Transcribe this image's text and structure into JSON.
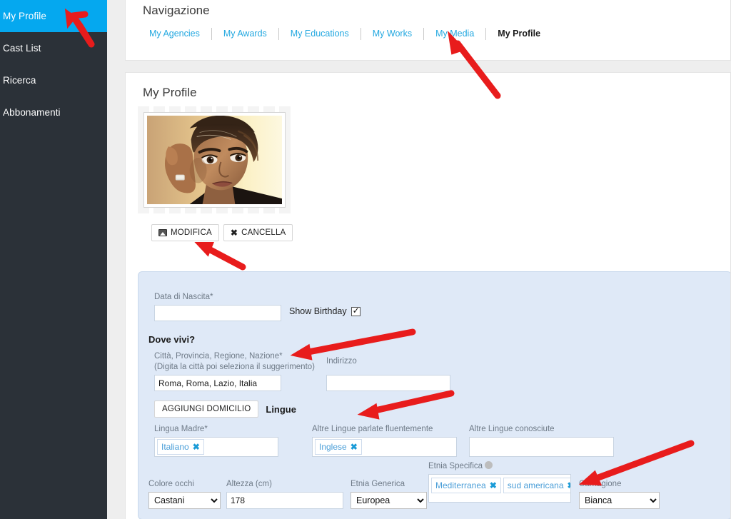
{
  "sidebar": {
    "items": [
      {
        "label": "My Profile",
        "active": true
      },
      {
        "label": "Cast List",
        "active": false
      },
      {
        "label": "Ricerca",
        "active": false
      },
      {
        "label": "Abbonamenti",
        "active": false
      }
    ]
  },
  "nav": {
    "title": "Navigazione",
    "tabs": [
      {
        "label": "My Agencies",
        "active": false
      },
      {
        "label": "My Awards",
        "active": false
      },
      {
        "label": "My Educations",
        "active": false
      },
      {
        "label": "My Works",
        "active": false
      },
      {
        "label": "My Media",
        "active": false
      },
      {
        "label": "My Profile",
        "active": true
      }
    ]
  },
  "profile": {
    "title": "My Profile",
    "photo_alt": "profile-photo",
    "buttons": {
      "edit": "MODIFICA",
      "delete": "CANCELLA"
    }
  },
  "form": {
    "birthdate": {
      "label": "Data di Nascita*",
      "value": "",
      "placeholder": ""
    },
    "show_birthday": {
      "label": "Show Birthday",
      "checked": true
    },
    "dove_vivi": "Dove vivi?",
    "city": {
      "label": "Città, Provincia, Regione, Nazione*",
      "hint": "(Digita la città poi seleziona il suggerimento)",
      "value": "Roma, Roma, Lazio, Italia"
    },
    "address": {
      "label": "Indirizzo",
      "value": ""
    },
    "add_domicile_button": "AGGIUNGI DOMICILIO",
    "lingue_heading": "Lingue",
    "mother_tongue": {
      "label": "Lingua Madre*",
      "tags": [
        "Italiano"
      ]
    },
    "fluent_languages": {
      "label": "Altre Lingue parlate fluentemente",
      "tags": [
        "Inglese"
      ]
    },
    "known_languages": {
      "label": "Altre Lingue conosciute",
      "tags": []
    },
    "eye_color": {
      "label": "Colore occhi",
      "value": "Castani"
    },
    "height": {
      "label": "Altezza (cm)",
      "value": "178"
    },
    "generic_ethnicity": {
      "label": "Etnia Generica",
      "value": "Europea"
    },
    "specific_ethnicity": {
      "label": "Etnia Specifica",
      "help_icon": "help-icon",
      "tags": [
        "Mediterranea",
        "sud americana"
      ]
    },
    "complexion": {
      "label": "Carnagione",
      "value": "Bianca"
    }
  },
  "colors": {
    "sidebar_bg": "#2b3138",
    "sidebar_active": "#05a8ef",
    "link": "#23a8e0",
    "panel_bg": "#dfe9f7",
    "annotation": "#e81c1c"
  },
  "annotations": {
    "count": 5,
    "color": "#e81c1c",
    "targets": [
      "sidebar-item-my-profile",
      "tab-my-profile",
      "edit-photo-button",
      "city-field-label",
      "fluent-languages-label",
      "complexion-label"
    ]
  }
}
